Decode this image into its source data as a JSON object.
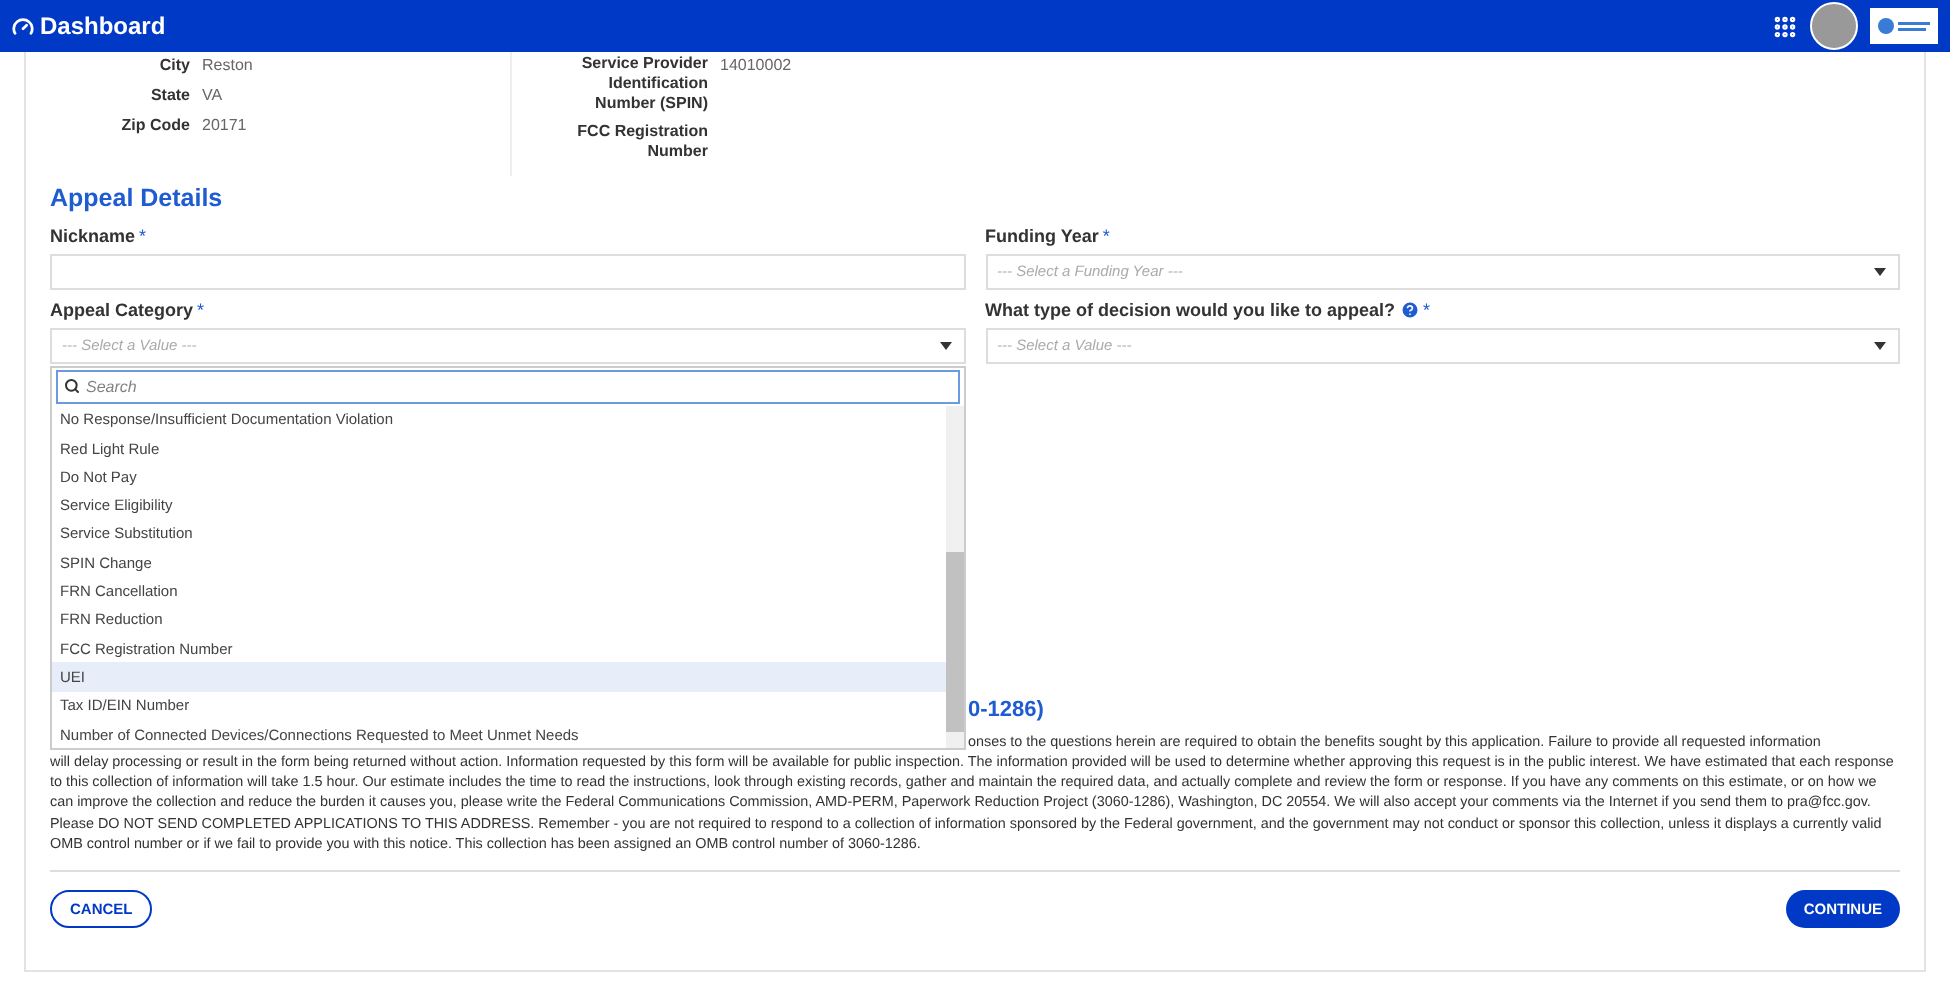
{
  "header": {
    "title": "Dashboard"
  },
  "summary": {
    "left": [
      {
        "label": "City",
        "value": "Reston"
      },
      {
        "label": "State",
        "value": "VA"
      },
      {
        "label": "Zip Code",
        "value": "20171"
      }
    ],
    "right": [
      {
        "label": "Service Provider Identification Number (SPIN)",
        "value": "14010002"
      },
      {
        "label": "FCC Registration Number"
      }
    ]
  },
  "appeal": {
    "heading": "Appeal Details",
    "fields": [
      {
        "kind": "text",
        "label": "Nickname",
        "required_mark": "*"
      },
      {
        "kind": "select",
        "label": "Funding Year",
        "required_mark": "*",
        "placeholder": "--- Select a Funding Year ---"
      },
      {
        "kind": "select",
        "label": "Appeal Category",
        "required_mark": "*",
        "placeholder": "--- Select a Value ---",
        "open": true
      },
      {
        "kind": "select",
        "label": "What type of decision would you like to appeal?",
        "required_mark": "*",
        "help": true,
        "placeholder": "--- Select a Value ---"
      }
    ]
  },
  "dropdown": {
    "search_placeholder": "Search",
    "options": [
      {
        "label": "No Response/Insufficient Documentation Violation",
        "selected": false
      },
      {
        "label": "Red Light Rule",
        "selected": false
      },
      {
        "label": "Do Not Pay",
        "selected": false
      },
      {
        "label": "Service Eligibility",
        "selected": false
      },
      {
        "label": "Service Substitution",
        "selected": false
      },
      {
        "label": "SPIN Change",
        "selected": false
      },
      {
        "label": "FRN Cancellation",
        "selected": false
      },
      {
        "label": "FRN Reduction",
        "selected": false
      },
      {
        "label": "FCC Registration Number",
        "selected": false
      },
      {
        "label": "UEI",
        "selected": true
      },
      {
        "label": "Tax ID/EIN Number",
        "selected": false
      },
      {
        "label": "Number of Connected Devices/Connections Requested to Meet Unmet Needs",
        "selected": false
      }
    ]
  },
  "notice": {
    "heading_fragment": "0-1286)",
    "first_line_fragment": "onses to the questions herein are required to obtain the benefits sought by this application. Failure to provide all requested information",
    "text": "will delay processing or result in the form being returned without action. Information requested by this form will be available for public inspection. The information provided will be used to determine whether approving this request is in the public interest. We have estimated that each response to this collection of information will take 1.5 hour. Our estimate includes the time to read the instructions, look through existing records, gather and maintain the required data, and actually complete and review the form or response. If you have any comments on this estimate, or on how we can improve the collection and reduce the burden it causes you, please write the Federal Communications Commission, AMD-PERM, Paperwork Reduction Project (3060-1286), Washington, DC 20554. We will also accept your comments via the Internet if you send them to pra@fcc.gov. Please DO NOT SEND COMPLETED APPLICATIONS TO THIS ADDRESS. Remember - you are not required to respond to a collection of information sponsored by the Federal government, and the government may not conduct or sponsor this collection, unless it displays a currently valid OMB control number or if we fail to provide you with this notice. This collection has been assigned an OMB control number of 3060-1286."
  },
  "buttons": [
    {
      "label": "CANCEL",
      "kind": "secondary"
    },
    {
      "label": "CONTINUE",
      "kind": "primary"
    }
  ]
}
